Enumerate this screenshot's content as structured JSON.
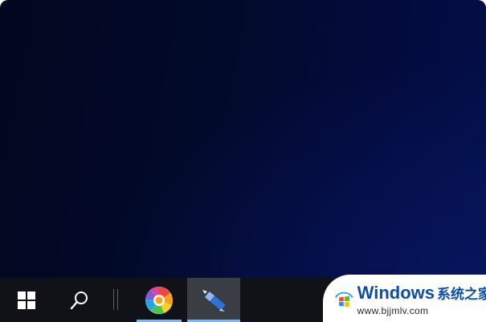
{
  "taskbar": {
    "start_icon": "windows-logo-icon",
    "search_icon": "search-icon",
    "apps": [
      {
        "icon": "colorful-pinwheel-app-icon",
        "active": true
      },
      {
        "icon": "pen-app-icon",
        "active": true,
        "focused": true
      }
    ],
    "background_color": "#101217",
    "active_indicator_color": "#7eb7ec"
  },
  "desktop": {
    "background_color": "#020a2c"
  },
  "watermark": {
    "title": "Windows",
    "title_cn": "系统之家",
    "url": "www.bjjmlv.com",
    "logo_icon": "windows-flag-logo-icon"
  }
}
